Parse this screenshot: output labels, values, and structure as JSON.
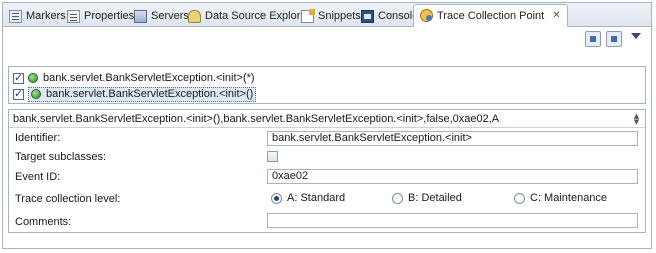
{
  "tabs": [
    {
      "label": "Markers",
      "icon": "markers-icon"
    },
    {
      "label": "Properties",
      "icon": "properties-icon"
    },
    {
      "label": "Servers",
      "icon": "servers-icon"
    },
    {
      "label": "Data Source Explorer",
      "icon": "data-source-icon"
    },
    {
      "label": "Snippets",
      "icon": "snippets-icon"
    },
    {
      "label": "Console",
      "icon": "console-icon"
    },
    {
      "label": "Trace Collection Point",
      "icon": "trace-icon",
      "active": true,
      "close": "✕"
    }
  ],
  "list": {
    "items": [
      {
        "label": "bank.servlet.BankServletException.<init>(*)",
        "checked": true,
        "selected": false
      },
      {
        "label": "bank.servlet.BankServletException.<init>()",
        "checked": true,
        "selected": true
      }
    ]
  },
  "details": {
    "summary": "bank.servlet.BankServletException.<init>(),bank.servlet.BankServletException.<init>,false,0xae02,A",
    "identifier_label": "Identifier:",
    "identifier_value": "bank.servlet.BankServletException.<init>",
    "target_subclasses_label": "Target subclasses:",
    "target_subclasses_checked": false,
    "event_id_label": "Event ID:",
    "event_id_value": "0xae02",
    "trace_level_label": "Trace collection level:",
    "trace_levels": [
      {
        "label": "A: Standard",
        "selected": true
      },
      {
        "label": "B: Detailed",
        "selected": false
      },
      {
        "label": "C: Maintenance",
        "selected": false
      }
    ],
    "comments_label": "Comments:",
    "comments_value": ""
  }
}
